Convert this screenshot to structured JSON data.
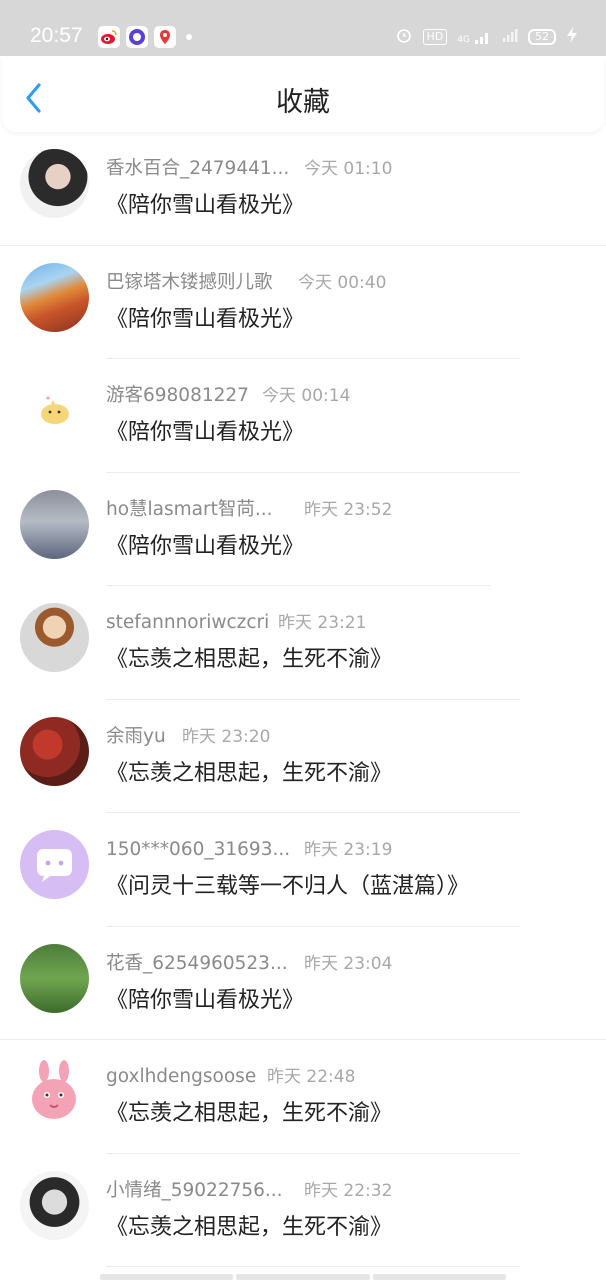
{
  "status_bar": {
    "time": "20:57",
    "hd": "HD",
    "signal": "4G",
    "battery": "52"
  },
  "nav": {
    "title": "收藏"
  },
  "favorites": [
    {
      "user": "香水百合_2479441...",
      "time": "今天 01:10",
      "title": "《陪你雪山看极光》"
    },
    {
      "user": "巴镓塔木镂撼则儿歌",
      "time": "今天 00:40",
      "title": "《陪你雪山看极光》"
    },
    {
      "user": "游客698081227",
      "time": "今天 00:14",
      "title": "《陪你雪山看极光》"
    },
    {
      "user": "ho慧lasmart智苘...",
      "time": "昨天 23:52",
      "title": "《陪你雪山看极光》"
    },
    {
      "user": "stefannnoriwczcri",
      "time": "昨天 23:21",
      "title": "《忘羡之相思起，生死不渝》"
    },
    {
      "user": "余雨yu",
      "time": "昨天 23:20",
      "title": "《忘羡之相思起，生死不渝》"
    },
    {
      "user": "150***060_31693...",
      "time": "昨天 23:19",
      "title": "《问灵十三载等一不归人（蓝湛篇）》"
    },
    {
      "user": "花香_6254960523...",
      "time": "昨天 23:04",
      "title": "《陪你雪山看极光》"
    },
    {
      "user": "goxlhdengsoose",
      "time": "昨天 22:48",
      "title": "《忘羡之相思起，生死不渝》"
    },
    {
      "user": "小情绪_59022756...",
      "time": "昨天 22:32",
      "title": "《忘羡之相思起，生死不渝》"
    }
  ],
  "colors": {
    "accent": "#2f9ef0",
    "status_bar_bg": "#d7d7d7",
    "username": "#8a8a8a",
    "timestamp": "#a8a8a8"
  }
}
